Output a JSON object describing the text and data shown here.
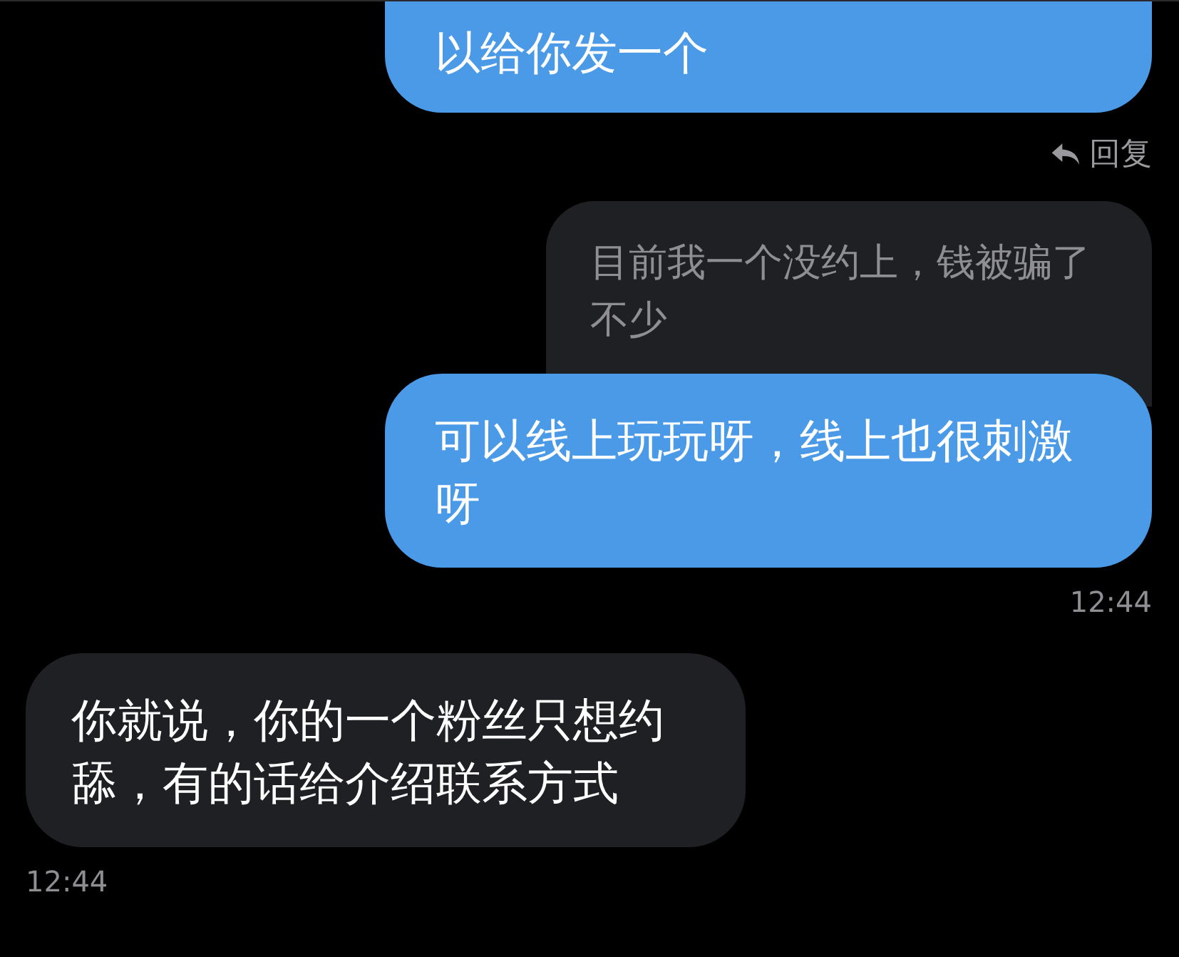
{
  "messages": [
    {
      "kind": "outgoing",
      "text": "以给你发一个",
      "reply_label": "回复"
    },
    {
      "kind": "outgoing",
      "quote": "目前我一个没约上，钱被骗了不少",
      "text": "可以线上玩玩呀，线上也很刺激呀",
      "time": "12:44"
    },
    {
      "kind": "incoming",
      "text": "你就说，你的一个粉丝只想约舔，有的话给介绍联系方式",
      "time": "12:44"
    }
  ]
}
